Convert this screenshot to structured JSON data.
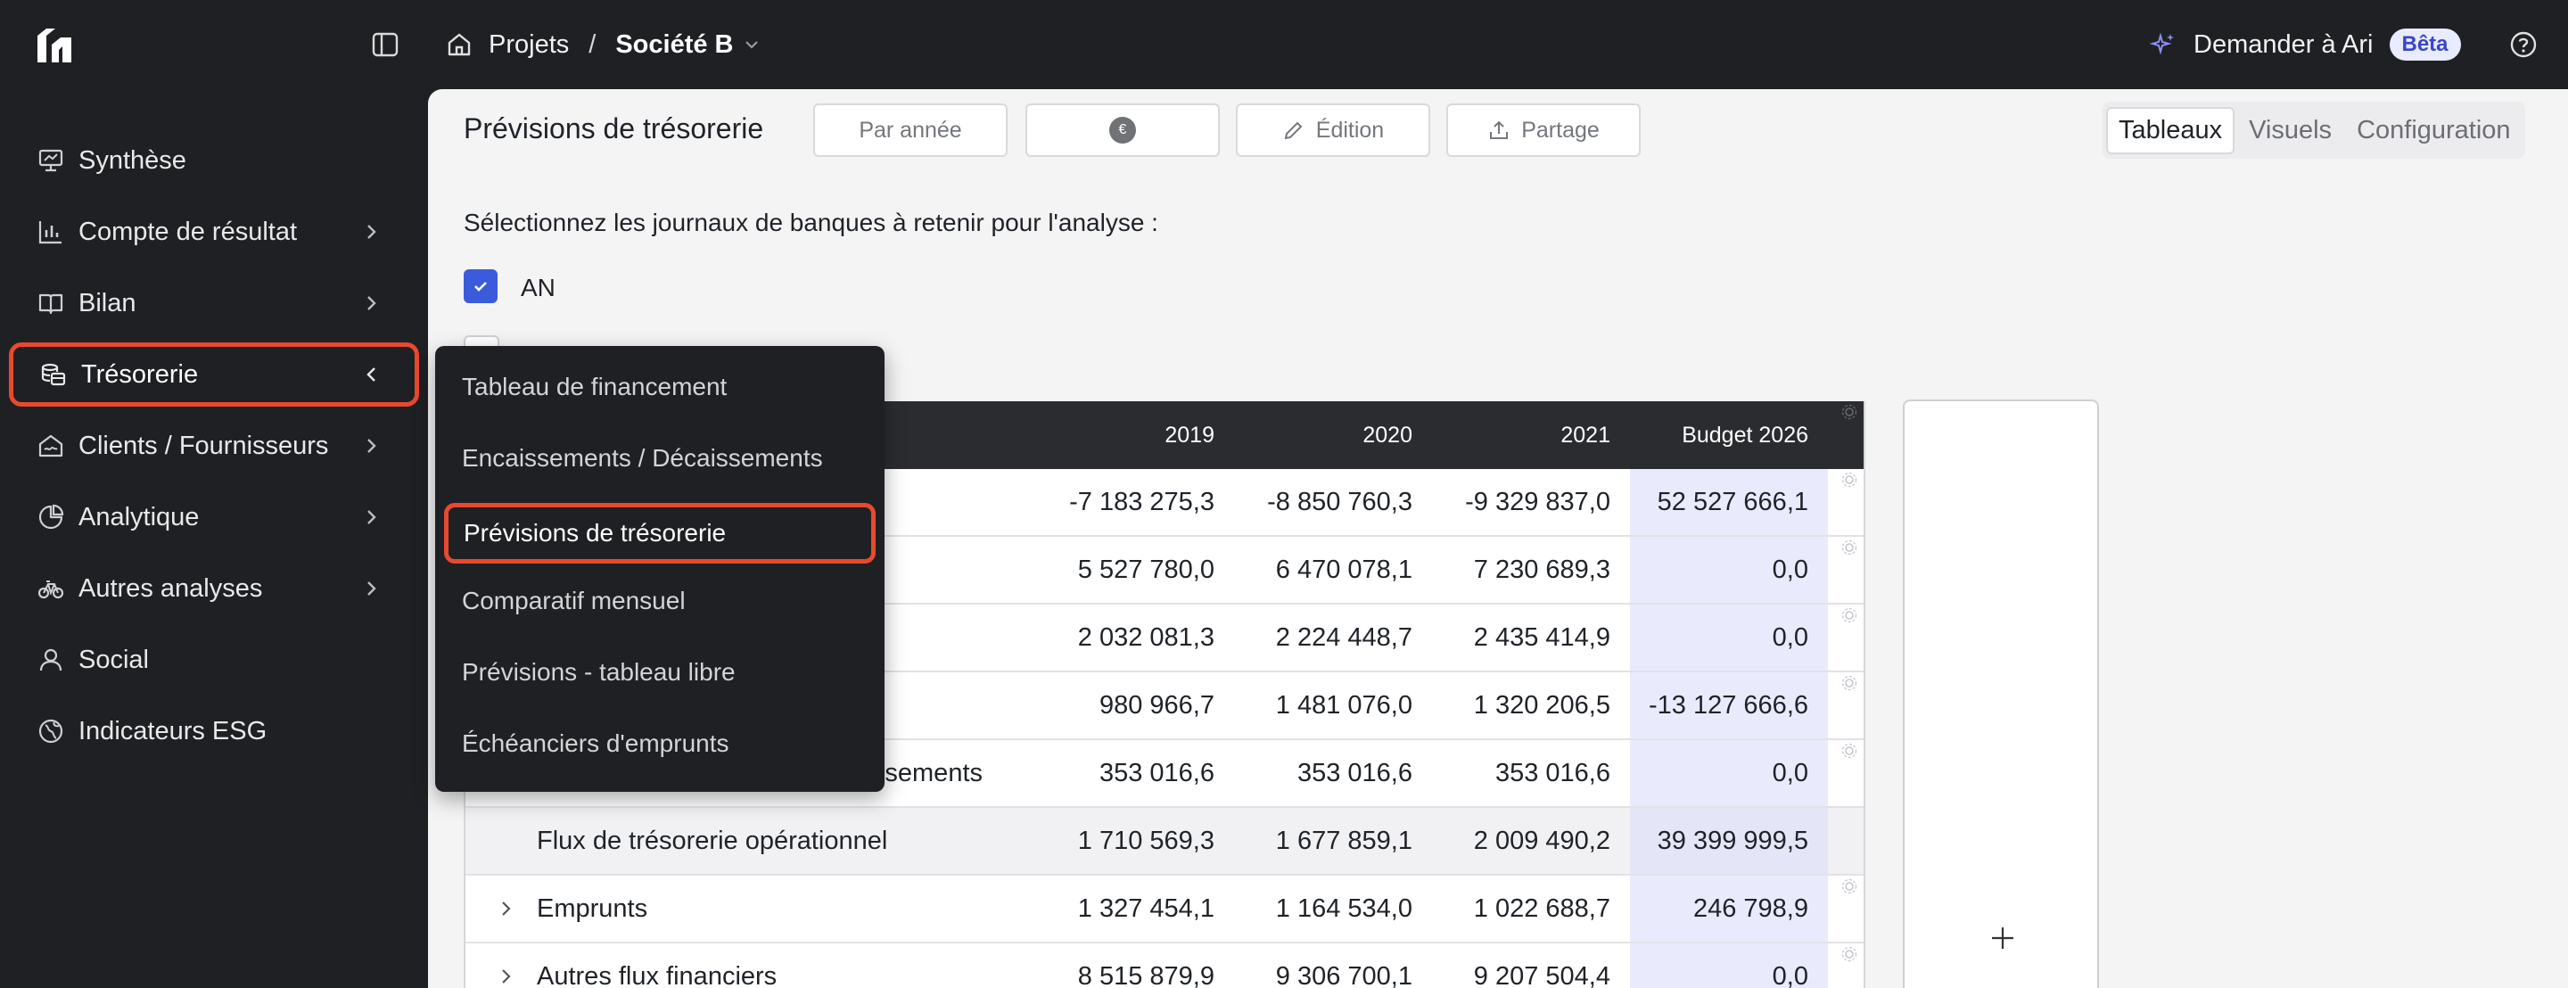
{
  "topbar": {
    "breadcrumb_root": "Projets",
    "breadcrumb_separator": "/",
    "breadcrumb_current": "Société B",
    "ask_label": "Demander à Ari",
    "beta_badge": "Bêta"
  },
  "sidebar": {
    "items": [
      {
        "label": "Synthèse",
        "icon": "presentation-icon",
        "has_chevron": false
      },
      {
        "label": "Compte de résultat",
        "icon": "bar-chart-icon",
        "has_chevron": true
      },
      {
        "label": "Bilan",
        "icon": "book-open-icon",
        "has_chevron": true
      },
      {
        "label": "Trésorerie",
        "icon": "coins-icon",
        "has_chevron": true,
        "active": true
      },
      {
        "label": "Clients / Fournisseurs",
        "icon": "handshake-icon",
        "has_chevron": true
      },
      {
        "label": "Analytique",
        "icon": "pie-chart-icon",
        "has_chevron": true
      },
      {
        "label": "Autres analyses",
        "icon": "bike-icon",
        "has_chevron": true
      },
      {
        "label": "Social",
        "icon": "user-icon",
        "has_chevron": false
      },
      {
        "label": "Indicateurs ESG",
        "icon": "leaf-globe-icon",
        "has_chevron": false
      }
    ]
  },
  "submenu": {
    "items": [
      {
        "label": "Tableau de financement"
      },
      {
        "label": "Encaissements / Décaissements"
      },
      {
        "label": "Prévisions de trésorerie",
        "active": true
      },
      {
        "label": "Comparatif mensuel"
      },
      {
        "label": "Prévisions - tableau libre"
      },
      {
        "label": "Échéanciers d'emprunts"
      }
    ]
  },
  "toolbar": {
    "title": "Prévisions de trésorerie",
    "period_label": "Par année",
    "currency_symbol": "€",
    "edit_label": "Édition",
    "share_label": "Partage",
    "view_tabs": [
      "Tableaux",
      "Visuels",
      "Configuration"
    ],
    "active_view": "Tableaux"
  },
  "filters": {
    "instruction": "Sélectionnez les journaux de banques à retenir pour l'analyse :",
    "journals": [
      {
        "label": "AN",
        "checked": true
      }
    ]
  },
  "table": {
    "columns": [
      "2019",
      "2020",
      "2021",
      "Budget 2026"
    ],
    "rows": [
      {
        "label": "",
        "values": [
          "-7 183 275,3",
          "-8 850 760,3",
          "-9 329 837,0",
          "52 527 666,1"
        ]
      },
      {
        "label": "",
        "values": [
          "5 527 780,0",
          "6 470 078,1",
          "7 230 689,3",
          "0,0"
        ]
      },
      {
        "label": "",
        "values": [
          "2 032 081,3",
          "2 224 448,7",
          "2 435 414,9",
          "0,0"
        ]
      },
      {
        "label": "",
        "values": [
          "980 966,7",
          "1 481 076,0",
          "1 320 206,5",
          "-13 127 666,6"
        ]
      },
      {
        "label": "aissements",
        "values": [
          "353 016,6",
          "353 016,6",
          "353 016,6",
          "0,0"
        ]
      },
      {
        "label": "Flux de trésorerie opérationnel",
        "values": [
          "1 710 569,3",
          "1 677 859,1",
          "2 009 490,2",
          "39 399 999,5"
        ],
        "subtotal": true
      },
      {
        "label": "Emprunts",
        "values": [
          "1 327 454,1",
          "1 164 534,0",
          "1 022 688,7",
          "246 798,9"
        ],
        "expandable": true
      },
      {
        "label": "Autres flux financiers",
        "values": [
          "8 515 879,9",
          "9 306 700,1",
          "9 207 504,4",
          "0,0"
        ],
        "expandable": true
      }
    ]
  },
  "colors": {
    "accent": "#3b5bdb",
    "highlight": "#e8492f",
    "budget_column": "#e9ebfc"
  }
}
